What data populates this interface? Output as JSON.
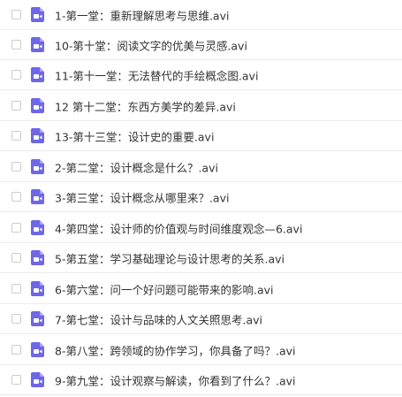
{
  "icon_color": "#6e67e8",
  "files": [
    {
      "name": "1-第一堂：重新理解思考与思维.avi",
      "icon": "video-file-icon"
    },
    {
      "name": "10-第十堂：阅读文字的优美与灵感.avi",
      "icon": "video-file-icon"
    },
    {
      "name": "11-第十一堂：无法替代的手绘概念图.avi",
      "icon": "video-file-icon"
    },
    {
      "name": "12 第十二堂：东西方美学的差异.avi",
      "icon": "video-file-icon"
    },
    {
      "name": "13-第十三堂：设计史的重要.avi",
      "icon": "video-file-icon"
    },
    {
      "name": "2-第二堂：设计概念是什么？.avi",
      "icon": "video-file-icon"
    },
    {
      "name": "3-第三堂：设计概念从哪里来？.avi",
      "icon": "video-file-icon"
    },
    {
      "name": "4-第四堂：设计师的价值观与时间维度观念—6.avi",
      "icon": "video-file-icon"
    },
    {
      "name": "5-第五堂：学习基础理论与设计思考的关系.avi",
      "icon": "video-file-icon"
    },
    {
      "name": "6-第六堂：问一个好问题可能带来的影响.avi",
      "icon": "video-file-icon"
    },
    {
      "name": "7-第七堂：设计与品味的人文关照思考.avi",
      "icon": "video-file-icon"
    },
    {
      "name": "8-第八堂：跨领域的协作学习，你具备了吗？.avi",
      "icon": "video-file-icon"
    },
    {
      "name": "9-第九堂：设计观察与解读，你看到了什么？.avi",
      "icon": "video-file-icon"
    }
  ]
}
